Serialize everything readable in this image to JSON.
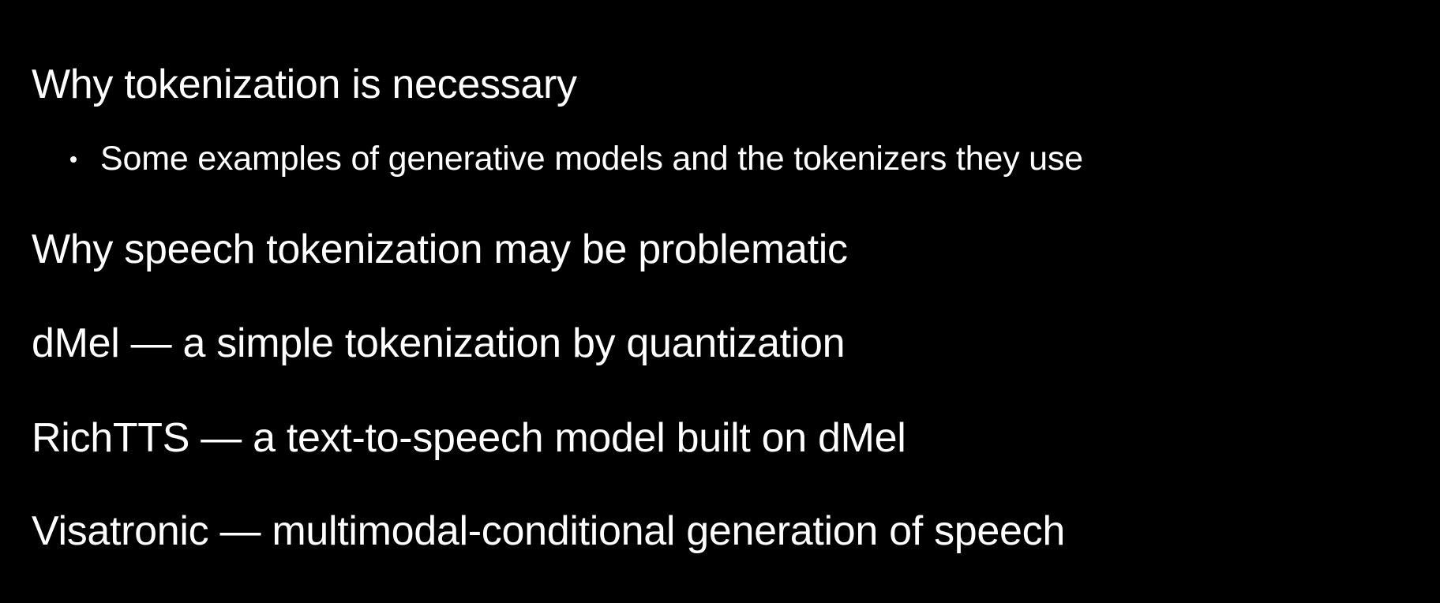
{
  "slide": {
    "items": [
      {
        "label": "Why tokenization is necessary",
        "subitems": [
          "Some examples of generative models and the tokenizers they use"
        ]
      },
      {
        "label": "Why speech tokenization may be problematic"
      },
      {
        "label": "dMel — a simple tokenization by quantization"
      },
      {
        "label": "RichTTS — a text-to-speech model built on dMel"
      },
      {
        "label": "Visatronic — multimodal-conditional generation of speech"
      }
    ]
  }
}
